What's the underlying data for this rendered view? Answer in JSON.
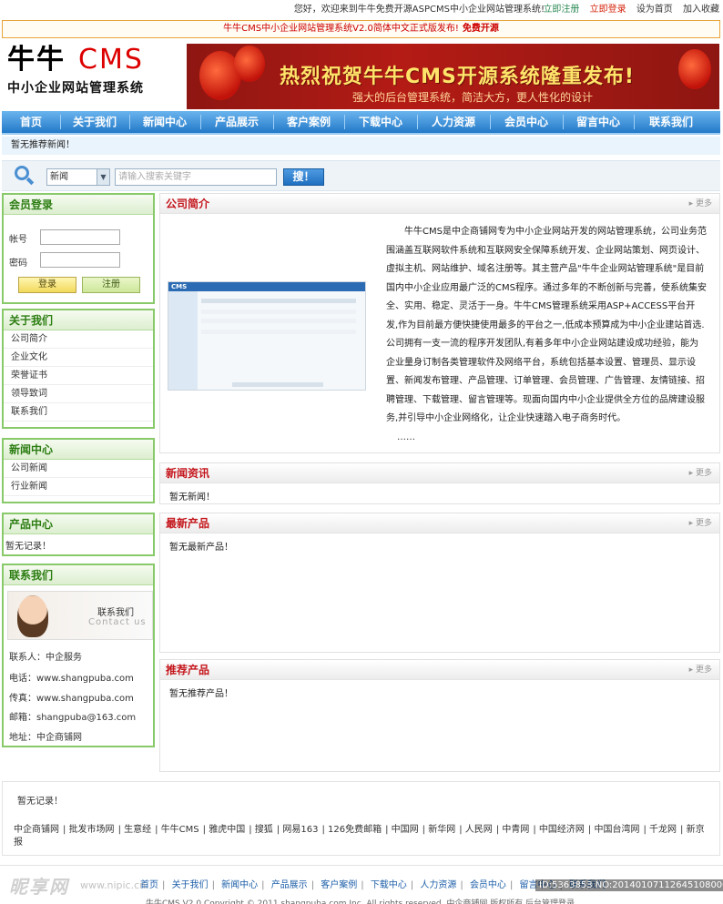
{
  "topbar": {
    "welcome": "您好，欢迎来到牛牛免费开源ASPCMS中小企业网站管理系统!",
    "register": "立即注册",
    "login": "立即登录",
    "homepage": "设为首页",
    "favorite": "加入收藏"
  },
  "notice": {
    "text": "牛牛CMS中小企业网站管理系统V2.0简体中文正式版发布!",
    "strong": "免费开源"
  },
  "logo": {
    "main": "牛牛",
    "cms": "CMS",
    "sub": "中小企业网站管理系统"
  },
  "banner": {
    "title": "热烈祝贺牛牛CMS开源系统隆重发布!",
    "subtitle": "强大的后台管理系统，简洁大方，更人性化的设计"
  },
  "nav": [
    "首页",
    "关于我们",
    "新闻中心",
    "产品展示",
    "客户案例",
    "下载中心",
    "人力资源",
    "会员中心",
    "留言中心",
    "联系我们"
  ],
  "ticker": "暂无推荐新闻！",
  "search": {
    "select": "新闻",
    "placeholder": "请输入搜索关键字",
    "button": "搜！"
  },
  "member": {
    "title": "会员登录",
    "account": "帐号",
    "password": "密码",
    "login_btn": "登录",
    "register_btn": "注册"
  },
  "about": {
    "title": "关于我们",
    "items": [
      "公司简介",
      "企业文化",
      "荣誉证书",
      "领导致词",
      "联系我们"
    ]
  },
  "news_center": {
    "title": "新闻中心",
    "items": [
      "公司新闻",
      "行业新闻"
    ]
  },
  "product_center": {
    "title": "产品中心",
    "empty": "暂无记录！"
  },
  "contact": {
    "title": "联系我们",
    "img_cn": "联系我们",
    "img_en": "Contact us",
    "lines": [
      "联系人：中企服务",
      "电话：www.shangpuba.com",
      "传真：www.shangpuba.com",
      "邮箱：shangpuba@163.com",
      "地址：中企商铺网"
    ]
  },
  "company": {
    "title": "公司简介",
    "more": "更多",
    "intro": "牛牛CMS是中企商铺网专为中小企业网站开发的网站管理系统，公司业务范围涵盖互联网软件系统和互联网安全保障系统开发、企业网站策划、网页设计、虚拟主机、网站维护、域名注册等。其主营产品\"牛牛企业网站管理系统\"是目前国内中小企业应用最广泛的CMS程序。通过多年的不断创新与完善，使系统集安全、实用、稳定、灵活于一身。牛牛CMS管理系统采用ASP+ACCESS平台开发,作为目前最方便快捷使用最多的平台之一,低成本预算成为中小企业建站首选.公司拥有一支一流的程序开发团队,有着多年中小企业网站建设成功经验，能为企业量身订制各类管理软件及网络平台，系统包括基本设置、管理员、显示设置、新闻发布管理、产品管理、订单管理、会员管理、广告管理、友情链接、招聘管理、下载管理、留言管理等。现面向国内中小企业提供全方位的品牌建设服务,并引导中小企业网络化，让企业快速踏入电子商务时代。",
    "ellipsis": "……",
    "shot_logo": "CMS"
  },
  "news_info": {
    "title": "新闻资讯",
    "more": "更多",
    "empty": "暂无新闻！"
  },
  "latest_products": {
    "title": "最新产品",
    "more": "更多",
    "empty": "暂无最新产品！"
  },
  "recommended": {
    "title": "推荐产品",
    "more": "更多",
    "empty": "暂无推荐产品！"
  },
  "footer": {
    "empty": "暂无记录！",
    "links": [
      "中企商铺网",
      "批发市场网",
      "生意经",
      "牛牛CMS",
      "雅虎中国",
      "搜狐",
      "网易163",
      "126免费邮箱",
      "中国网",
      "新华网",
      "人民网",
      "中青网",
      "中国经济网",
      "中国台湾网",
      "千龙网",
      "新京报"
    ],
    "bottom_nav": [
      "首页",
      "关于我们",
      "新闻中心",
      "产品展示",
      "客户案例",
      "下载中心",
      "人力资源",
      "会员中心",
      "留言中心",
      "联系我们"
    ],
    "copyright": "牛牛CMS V2.0 Copyright © 2011 shangpuba.com Inc. All rights reserved. 中企商铺网 版权所有 后台管理登录"
  },
  "watermark": {
    "brand": "昵享网",
    "url": "www.nipic.cn",
    "id": "ID:5363853 NO:20140107112645108000"
  }
}
